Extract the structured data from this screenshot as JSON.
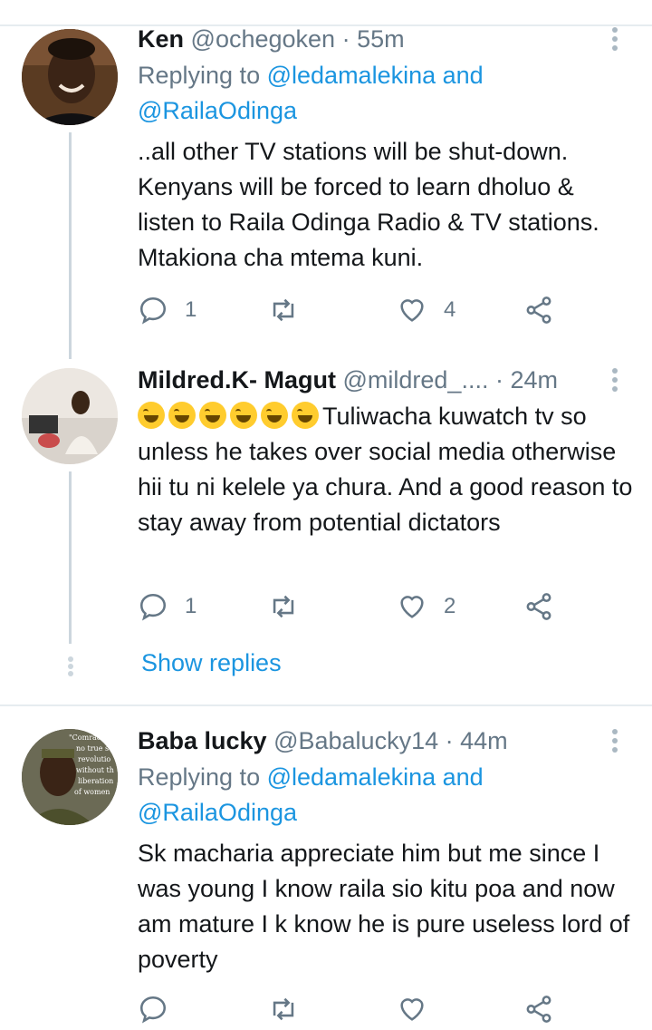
{
  "tweets": [
    {
      "name": "Ken",
      "handle": "@ochegoken",
      "time": "55m",
      "replying_prefix": "Replying to",
      "replying_to_1": "@ledamalekina and",
      "replying_to_2": "@RailaOdinga",
      "text": "..all other TV stations  will be shut-down. Kenyans will be forced to learn dholuo & listen to Raila Odinga Radio & TV stations. Mtakiona cha mtema kuni.",
      "replies": "1",
      "retweets": "",
      "likes": "4"
    },
    {
      "name": "Mildred.K- Magut",
      "handle": "@mildred_....",
      "time": "24m",
      "text": "Tuliwacha kuwatch tv so unless he takes over social media otherwise hii tu ni kelele ya chura. And a good reason to stay away from potential dictators",
      "emoji_count": 6,
      "replies": "1",
      "retweets": "",
      "likes": "2"
    },
    {
      "name": "Baba lucky",
      "handle": "@Babalucky14",
      "time": "44m",
      "replying_prefix": "Replying to",
      "replying_to_1": "@ledamalekina and",
      "replying_to_2": "@RailaOdinga",
      "text": "Sk macharia appreciate him but me since I was young I know raila sio kitu poa and now am mature I k know he is pure useless lord of poverty"
    }
  ],
  "show_replies_label": "Show replies",
  "avatar_3_text": {
    "line1": "\"Comrades",
    "line2": "no true so",
    "line3": "revolutio",
    "line4": "without th",
    "line5": "liberation",
    "line6": "of women"
  },
  "colors": {
    "link": "#1b95e0",
    "secondary": "#657786",
    "divider": "#e6ecf0",
    "thread_line": "#ccd6dd"
  },
  "icons": [
    "reply-icon",
    "retweet-icon",
    "like-icon",
    "share-icon",
    "more-icon"
  ]
}
